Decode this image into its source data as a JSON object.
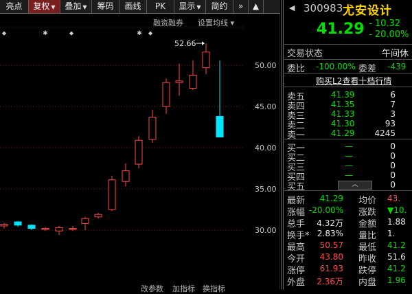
{
  "toolbar": {
    "items": [
      {
        "label": "亮点",
        "width": 42,
        "active": false,
        "dropdown": false
      },
      {
        "label": "复权",
        "width": 46,
        "active": true,
        "dropdown": true
      },
      {
        "label": "叠加",
        "width": 46,
        "active": false,
        "dropdown": true
      },
      {
        "label": "筹码",
        "width": 40,
        "active": false,
        "dropdown": false
      },
      {
        "label": "画线",
        "width": 40,
        "active": false,
        "dropdown": false
      },
      {
        "label": "PK",
        "width": 40,
        "active": false,
        "dropdown": false
      },
      {
        "label": "显示",
        "width": 46,
        "active": false,
        "dropdown": true
      },
      {
        "label": "简约",
        "width": 40,
        "active": false,
        "dropdown": false
      },
      {
        "label": "»",
        "width": 22,
        "active": false,
        "dropdown": false
      },
      {
        "label": "▲",
        "width": 22,
        "active": false,
        "dropdown": false
      }
    ]
  },
  "chart": {
    "links": {
      "margin": "融资融券",
      "ma_settings": "设置均线"
    },
    "bottom_links": {
      "a": "改参数",
      "b": "加指标",
      "c": "换指标"
    },
    "peak_label": "52.66",
    "y_ticks": [
      "50.00",
      "45.00",
      "40.00",
      "35.00",
      "30.00"
    ]
  },
  "chart_data": {
    "type": "candlestick",
    "y_axis_ticks": [
      30,
      35,
      40,
      45,
      50
    ],
    "annotation": {
      "text": "52.66",
      "value": 52.66
    },
    "candles": [
      {
        "open": 30.5,
        "close": 30.7,
        "high": 30.9,
        "low": 30.2,
        "up": true
      },
      {
        "open": 31.0,
        "close": 30.6,
        "high": 31.1,
        "low": 30.4,
        "up": false
      },
      {
        "open": 30.6,
        "close": 30.2,
        "high": 30.7,
        "low": 30.0,
        "up": false
      },
      {
        "open": 30.1,
        "close": 30.2,
        "high": 30.4,
        "low": 29.9,
        "up": true
      },
      {
        "open": 29.9,
        "close": 30.3,
        "high": 30.5,
        "low": 29.4,
        "up": true
      },
      {
        "open": 30.1,
        "close": 30.2,
        "high": 30.5,
        "low": 29.9,
        "up": true
      },
      {
        "open": 30.8,
        "close": 31.4,
        "high": 31.6,
        "low": 30.0,
        "up": true
      },
      {
        "open": 31.6,
        "close": 31.9,
        "high": 32.1,
        "low": 31.4,
        "up": true
      },
      {
        "open": 32.5,
        "close": 36.1,
        "high": 36.6,
        "low": 32.3,
        "up": true
      },
      {
        "open": 35.9,
        "close": 37.2,
        "high": 38.1,
        "low": 35.3,
        "up": true
      },
      {
        "open": 38.0,
        "close": 40.9,
        "high": 41.4,
        "low": 37.5,
        "up": true
      },
      {
        "open": 41.0,
        "close": 43.7,
        "high": 44.6,
        "low": 40.6,
        "up": true
      },
      {
        "open": 45.0,
        "close": 47.9,
        "high": 48.4,
        "low": 44.1,
        "up": true
      },
      {
        "open": 47.9,
        "close": 48.1,
        "high": 50.2,
        "low": 46.3,
        "up": true
      },
      {
        "open": 47.2,
        "close": 48.8,
        "high": 50.6,
        "low": 47.0,
        "up": true
      },
      {
        "open": 49.7,
        "close": 51.6,
        "high": 52.66,
        "low": 48.9,
        "up": true
      },
      {
        "open": 43.8,
        "close": 41.29,
        "high": 50.57,
        "low": 41.29,
        "up": false
      }
    ]
  },
  "quote": {
    "code": "300983",
    "name": "尤安设计",
    "price": "41.29",
    "change": "- 10.32",
    "change_pct": "- 20.00%"
  },
  "status": {
    "label": "交易状态",
    "value": "午间休"
  },
  "ratio": {
    "label1": "委比",
    "value1": "-100.00%",
    "label2": "委差",
    "value2": "-439"
  },
  "l2_link": "购买L2查看十档行情",
  "asks": [
    {
      "label": "卖五",
      "price": "41.39",
      "vol": "6"
    },
    {
      "label": "卖四",
      "price": "41.35",
      "vol": "7"
    },
    {
      "label": "卖三",
      "price": "41.33",
      "vol": "3"
    },
    {
      "label": "卖二",
      "price": "41.30",
      "vol": "93"
    },
    {
      "label": "卖一",
      "price": "41.29",
      "vol": "4245"
    }
  ],
  "bids": [
    {
      "label": "买一",
      "price": "—",
      "vol": "0"
    },
    {
      "label": "买二",
      "price": "—",
      "vol": "0"
    },
    {
      "label": "买三",
      "price": "—",
      "vol": "0"
    },
    {
      "label": "买四",
      "price": "—",
      "vol": "0"
    },
    {
      "label": "买五",
      "price": "—",
      "vol": "0"
    }
  ],
  "stats": [
    {
      "l1": "最新",
      "v1": "41.29",
      "c1": "green",
      "l2": "均价",
      "v2": "43.",
      "c2": "red"
    },
    {
      "l1": "涨幅",
      "v1": "-20.00%",
      "c1": "green",
      "l2": "涨跌",
      "v2": "▼10.",
      "c2": "green"
    },
    {
      "l1": "总手",
      "v1": "4.32万",
      "c1": "white",
      "l2": "金额",
      "v2": "1.88",
      "c2": "white"
    },
    {
      "l1": "换手*",
      "v1": "2.83%",
      "c1": "white",
      "l2": "量比",
      "v2": "1.",
      "c2": "white"
    },
    {
      "l1": "最高",
      "v1": "50.57",
      "c1": "red",
      "l2": "最低",
      "v2": "41.2",
      "c2": "green"
    },
    {
      "l1": "今开",
      "v1": "43.80",
      "c1": "red",
      "l2": "昨收",
      "v2": "51.6",
      "c2": "white"
    },
    {
      "l1": "涨停",
      "v1": "61.93",
      "c1": "red",
      "l2": "跌停",
      "v2": "41.2",
      "c2": "green"
    },
    {
      "l1": "外盘",
      "v1": "2.36万",
      "c1": "red",
      "l2": "内盘",
      "v2": "1.96",
      "c2": "green"
    }
  ],
  "colors": {
    "up": "#ff4a4a",
    "down": "#00e5ff",
    "down_text": "#00e000",
    "name": "#ffd800"
  },
  "icons": {
    "back": "chevron-left-icon",
    "collapse": "chevron-up-icon"
  }
}
